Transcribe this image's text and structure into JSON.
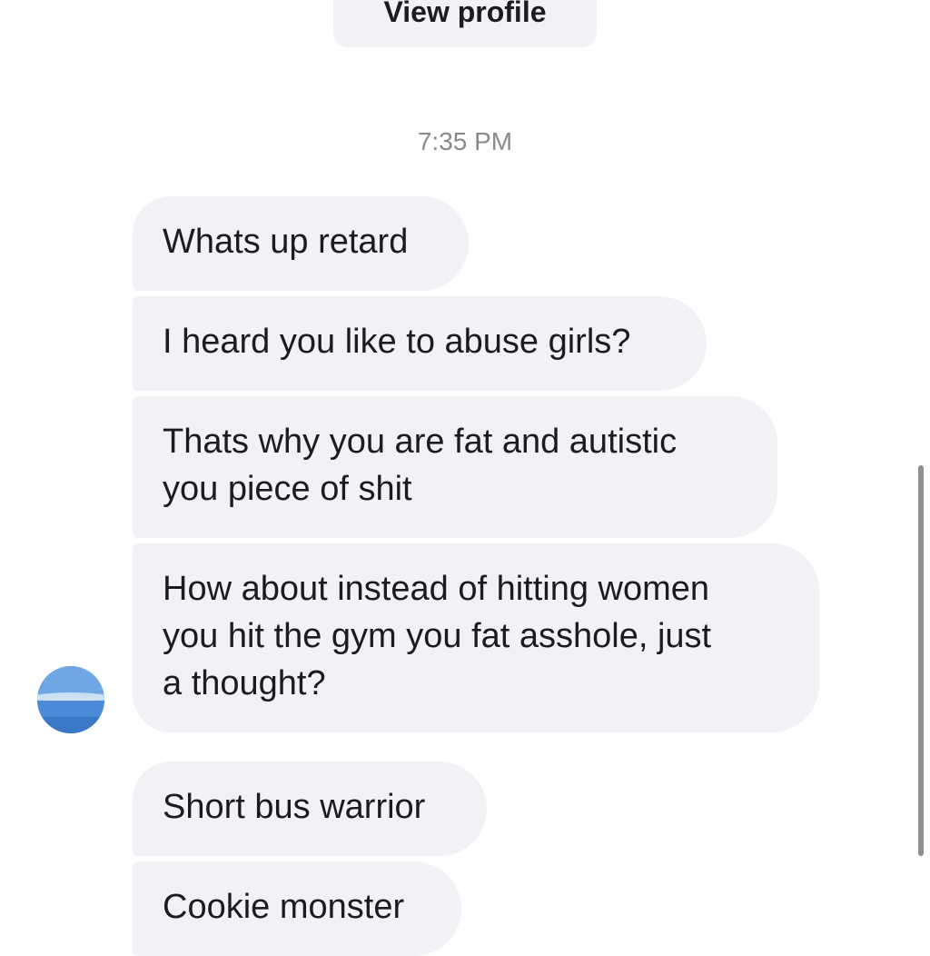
{
  "header": {
    "view_profile_label": "View profile",
    "timestamp": "7:35 PM"
  },
  "messages": [
    {
      "lines": [
        "Whats up retard"
      ]
    },
    {
      "lines": [
        "I heard you like to abuse girls?"
      ]
    },
    {
      "lines": [
        "Thats why you are fat and autistic",
        "you piece of shit"
      ]
    },
    {
      "lines": [
        "How about instead of hitting women",
        "you hit the gym you fat asshole, just",
        "a thought?"
      ]
    },
    {
      "lines": [
        "Short bus warrior"
      ]
    },
    {
      "lines": [
        "Cookie monster"
      ]
    }
  ],
  "colors": {
    "bubble_background": "#f1f2f6",
    "timestamp_text": "#8a8a8e",
    "message_text": "#1c1c1e",
    "scrollbar": "#8e8e93"
  },
  "icons": {
    "avatar": "sender-avatar-sky-photo"
  }
}
